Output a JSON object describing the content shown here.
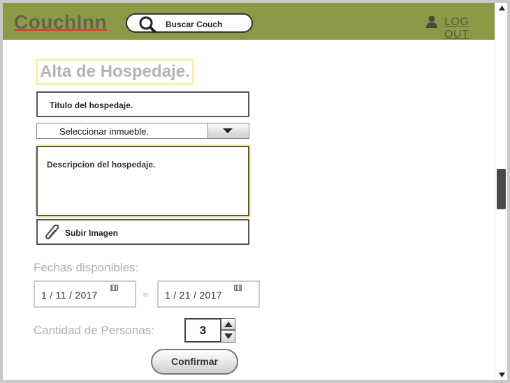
{
  "header": {
    "logo": "CouchInn",
    "search_label": "Buscar Couch",
    "logout_label": "LOG OUT"
  },
  "form": {
    "title": "Alta de Hospedaje.",
    "titulo_placeholder": "Titulo del hospedaje.",
    "inmueble_select": "Seleccionar inmueble.",
    "descripcion_placeholder": "Descripcion del hospedaje.",
    "upload_label": "Subir Imagen",
    "fechas_label": "Fechas disponibles:",
    "fecha_desde": "1 / 11 / 2017",
    "to_label": "to",
    "fecha_hasta": "1 / 21 / 2017",
    "personas_label": "Cantidad de Personas:",
    "personas_value": "3",
    "confirm_label": "Confirmar"
  },
  "colors": {
    "header_bg": "#8c9a48",
    "logo": "#62654a",
    "highlight": "#fbefb0"
  },
  "icons": {
    "search": "search-icon",
    "user": "user-icon",
    "dropdown": "chevron-down-icon",
    "attach": "paperclip-icon",
    "calendar": "calendar-icon"
  }
}
